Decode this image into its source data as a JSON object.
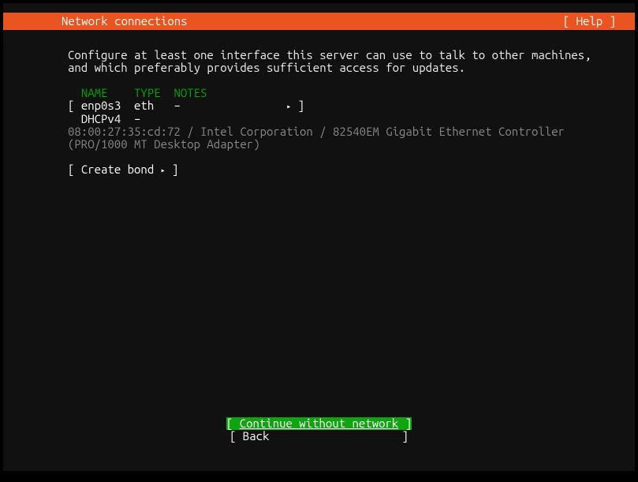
{
  "header": {
    "title": "Network connections",
    "help": "[ Help ]"
  },
  "intro": {
    "line1": "Configure at least one interface this server can use to talk to other machines,",
    "line2": "and which preferably provides sufficient access for updates."
  },
  "table": {
    "hdr_name": "NAME",
    "hdr_type": "TYPE",
    "hdr_notes": "NOTES",
    "iface_open": "[ ",
    "iface_name": "enp0s3",
    "iface_type": "eth",
    "iface_notes": "–",
    "arrow": "▸",
    "iface_close": " ]",
    "dhcp_label": "DHCPv4",
    "dhcp_value": "–",
    "hw1": "08:00:27:35:cd:72 / Intel Corporation / 82540EM Gigabit Ethernet Controller",
    "hw2": "(PRO/1000 MT Desktop Adapter)"
  },
  "create_bond": {
    "open": "[ ",
    "label": "Create bond",
    "arrow": "▸",
    "close": " ]"
  },
  "footer": {
    "continue_open": "[ ",
    "continue_label": "Continue without network",
    "continue_close": " ]",
    "back_open": "[ ",
    "back_label": "Back",
    "back_close": "]"
  }
}
